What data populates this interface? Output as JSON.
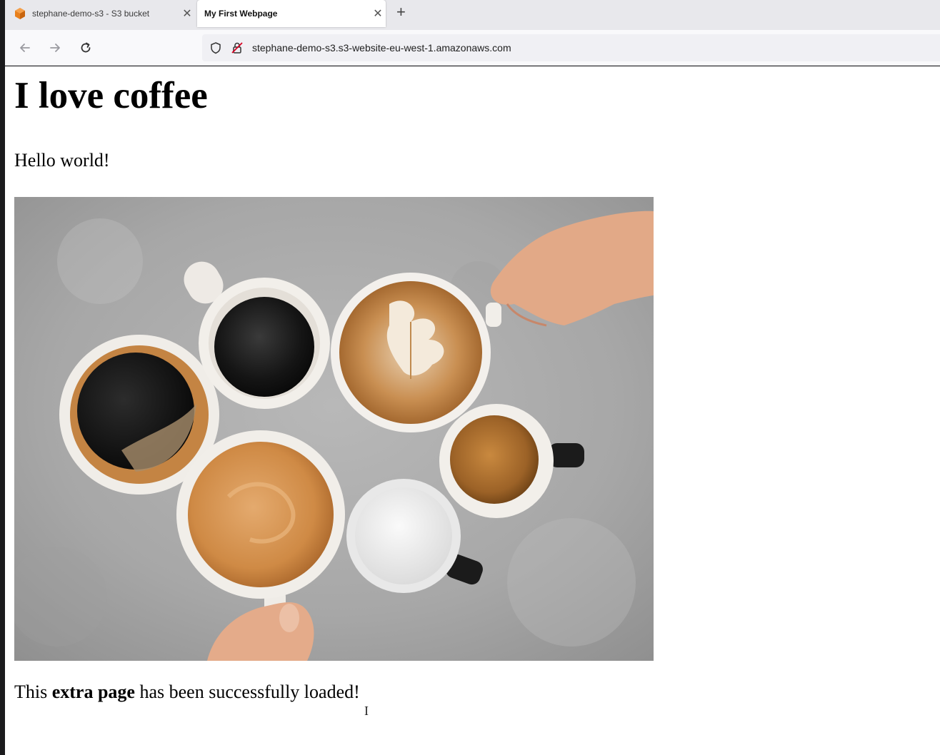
{
  "browser": {
    "tabs": [
      {
        "title": "stephane-demo-s3 - S3 bucket",
        "active": false,
        "favicon": "aws-s3-cube-icon"
      },
      {
        "title": "My First Webpage",
        "active": true,
        "favicon": "none"
      }
    ],
    "new_tab_icon": "plus-icon",
    "nav_icons": [
      "back-arrow-icon",
      "forward-arrow-icon",
      "reload-icon"
    ],
    "address_bar": {
      "url": "stephane-demo-s3.s3-website-eu-west-1.amazonaws.com",
      "icons": [
        "shield-icon",
        "insecure-lock-icon"
      ]
    }
  },
  "page": {
    "heading": "I love coffee",
    "paragraph": "Hello world!",
    "image": {
      "subject": "overhead photo of seven coffee cups on concrete surface with two hands"
    },
    "footer_parts": {
      "before": "This ",
      "bold": "extra page",
      "after": " has been successfully loaded!"
    }
  },
  "colors": {
    "tabbar_bg": "#e8e8ec",
    "navbar_bg": "#f9f9fb",
    "page_bg": "#ffffff",
    "aws_orange": "#e8801c"
  }
}
